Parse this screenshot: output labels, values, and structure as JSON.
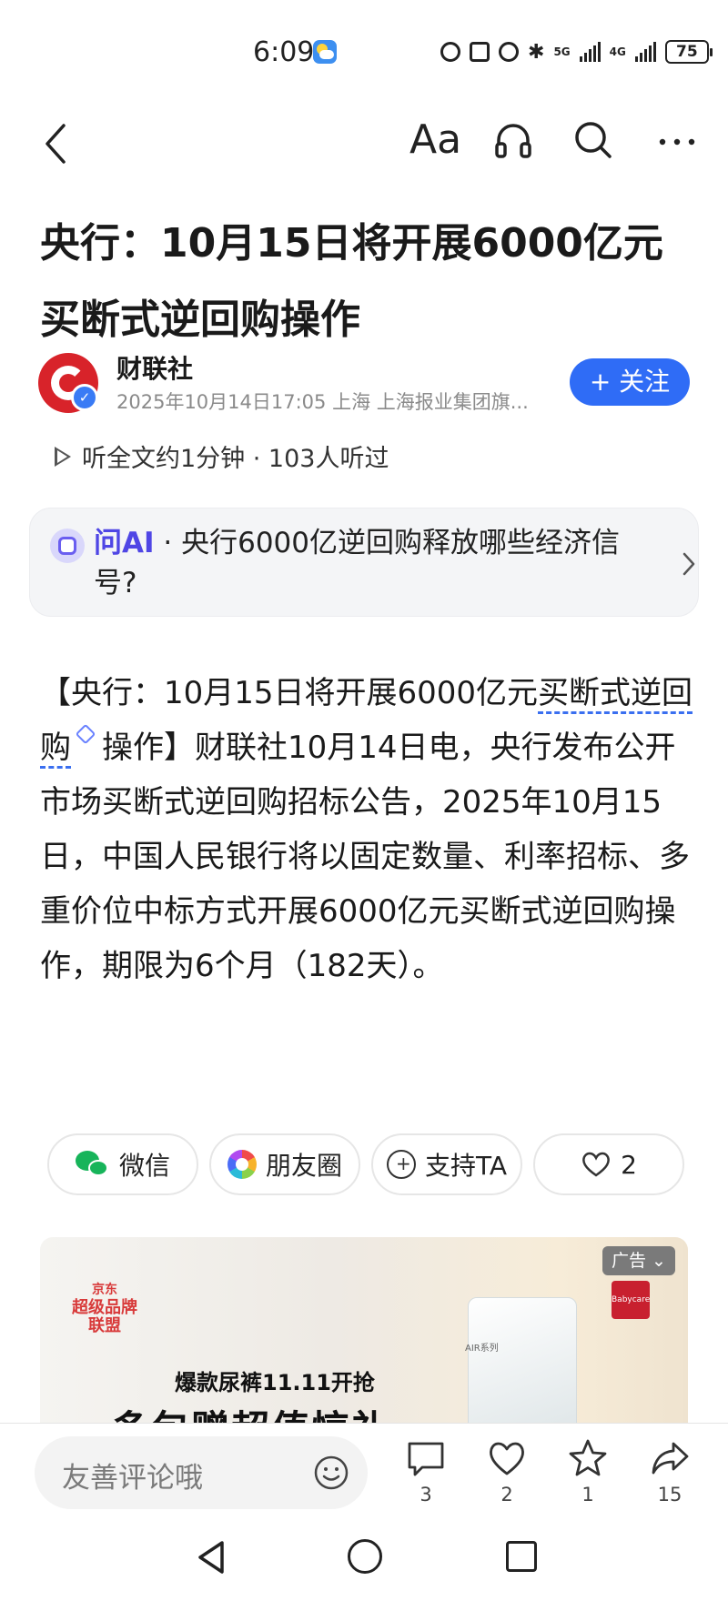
{
  "status": {
    "time": "6:09",
    "net_5g": "5G",
    "net_4g": "4G",
    "battery": "75"
  },
  "nav": {
    "font_size_label": "Aa"
  },
  "article": {
    "title": "央行：10月15日将开展6000亿元买断式逆回购操作",
    "author": "财联社",
    "meta": "2025年10月14日17:05 上海 上海报业集团旗...",
    "follow_label": "+ 关注",
    "listen_text": "听全文约1分钟 · 103人听过",
    "body_before": "【央行：10月15日将开展6000亿元",
    "body_term": "买断式逆回购",
    "body_after": "操作】财联社10月14日电，央行发布公开市场买断式逆回购招标公告，2025年10月15日，中国人民银行将以固定数量、利率招标、多重价位中标方式开展6000亿元买断式逆回购操作，期限为6个月（182天）。"
  },
  "ai_card": {
    "label": "问AI",
    "question": " · 央行6000亿逆回购释放哪些经济信号?"
  },
  "share": {
    "wechat": "微信",
    "moments": "朋友圈",
    "support": "支持TA",
    "like_count": "2"
  },
  "ad": {
    "tag": "广告",
    "brand_top": "京东",
    "brand": "超级品牌联盟",
    "subtitle": "爆款尿裤11.11开抢",
    "headline": "多包赠超值惊礼",
    "product_label": "AIR系列",
    "logo_text": "Babycare"
  },
  "bottom_bar": {
    "comment_placeholder": "友善评论哦",
    "comments": "3",
    "likes": "2",
    "favorites": "1",
    "shares": "15"
  }
}
